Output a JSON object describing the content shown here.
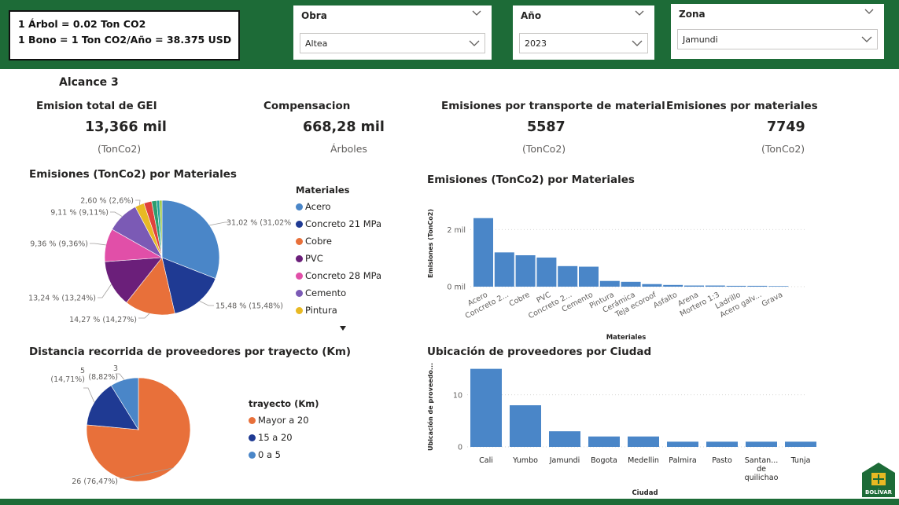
{
  "info": {
    "line1": "1 Árbol = 0.02 Ton CO2",
    "line2": "1 Bono = 1 Ton CO2/Año = 38.375 USD"
  },
  "slicers": {
    "obra": {
      "label": "Obra",
      "value": "Altea"
    },
    "anio": {
      "label": "Año",
      "value": "2023"
    },
    "zona": {
      "label": "Zona",
      "value": "Jamundi"
    }
  },
  "section_title": "Alcance 3",
  "kpis": [
    {
      "title": "Emision total de GEI",
      "value": "13,366 mil",
      "unit": "(TonCo2)"
    },
    {
      "title": "Compensacion",
      "value": "668,28 mil",
      "unit": "Árboles"
    },
    {
      "title": "Emisiones por transporte de material",
      "value": "5587",
      "unit": "(TonCo2)"
    },
    {
      "title": "Emisiones por materiales",
      "value": "7749",
      "unit": "(TonCo2)"
    }
  ],
  "colors": {
    "green_bar": "#1d6b37",
    "blue": "#4a86c8",
    "navy": "#1f3a93",
    "orange": "#e8703a",
    "purple": "#6b1f7a",
    "pink": "#e14fa8",
    "violet": "#7b5ab5",
    "yellow": "#e8b923"
  },
  "chart_data": [
    {
      "type": "pie",
      "title": "Emisiones (TonCo2) por Materiales",
      "legend_title": "Materiales",
      "legend_visible": [
        "Acero",
        "Concreto 21 MPa",
        "Cobre",
        "PVC",
        "Concreto 28 MPa",
        "Cemento",
        "Pintura"
      ],
      "slices": [
        {
          "label": "Acero",
          "value": 31.02,
          "data_label": "31,02 % (31,02%)",
          "color": "#4a86c8"
        },
        {
          "label": "Concreto 21 MPa",
          "value": 15.48,
          "data_label": "15,48 % (15,48%)",
          "color": "#1f3a93"
        },
        {
          "label": "Cobre",
          "value": 14.27,
          "data_label": "14,27 % (14,27%)",
          "color": "#e8703a"
        },
        {
          "label": "PVC",
          "value": 13.24,
          "data_label": "13,24 % (13,24%)",
          "color": "#6b1f7a"
        },
        {
          "label": "Concreto 28 MPa",
          "value": 9.36,
          "data_label": "9,36 % (9,36%)",
          "color": "#e14fa8"
        },
        {
          "label": "Cemento",
          "value": 9.11,
          "data_label": "9,11 % (9,11%)",
          "color": "#7b5ab5"
        },
        {
          "label": "Pintura",
          "value": 2.6,
          "data_label": "2,60 % (2,6%)",
          "color": "#e8b923"
        },
        {
          "label": "",
          "value": 2.2,
          "data_label": "",
          "color": "#e0413c"
        },
        {
          "label": "",
          "value": 1.4,
          "data_label": "",
          "color": "#2e9e6e"
        },
        {
          "label": "",
          "value": 0.8,
          "data_label": "",
          "color": "#1fa09a"
        },
        {
          "label": "",
          "value": 0.72,
          "data_label": "",
          "color": "#9ec843"
        }
      ]
    },
    {
      "type": "bar",
      "title": "Emisiones (TonCo2) por Materiales",
      "xlabel": "Materiales",
      "ylabel": "Emisiones (TonCo2)",
      "ylim": [
        0,
        2.75
      ],
      "yticks": [
        {
          "value": 0,
          "label": "0 mil"
        },
        {
          "value": 2,
          "label": "2 mil"
        }
      ],
      "categories": [
        "Acero",
        "Concreto 2...",
        "Cobre",
        "PVC",
        "Concreto 2...",
        "Cemento",
        "Pintura",
        "Cerámica",
        "Teja ecoroof",
        "Asfalto",
        "Arena",
        "Mortero 1:3",
        "Ladrillo",
        "Acero galv...",
        "Grava"
      ],
      "values": [
        2.4,
        1.2,
        1.1,
        1.02,
        0.72,
        0.7,
        0.2,
        0.17,
        0.09,
        0.06,
        0.04,
        0.04,
        0.03,
        0.03,
        0.02
      ],
      "color": "#4a86c8"
    },
    {
      "type": "pie",
      "title": "Distancia recorrida de proveedores por trayecto (Km)",
      "legend_title": "trayecto (Km)",
      "legend": [
        "Mayor a 20",
        "15 a 20",
        "0 a 5"
      ],
      "slices": [
        {
          "label": "Mayor a 20",
          "value": 26,
          "data_label": "26 (76,47%)",
          "color": "#e8703a"
        },
        {
          "label": "15 a 20",
          "value": 5,
          "data_label_1": "5",
          "data_label_2": "(14,71%)",
          "color": "#1f3a93"
        },
        {
          "label": "0 a 5",
          "value": 3,
          "data_label_1": "3",
          "data_label_2": "(8,82%)",
          "color": "#4a86c8"
        }
      ]
    },
    {
      "type": "bar",
      "title": "Ubicación de proveedores por Ciudad",
      "xlabel": "Ciudad",
      "ylabel": "Ubicación de proveedo...",
      "ylim": [
        0,
        16
      ],
      "yticks": [
        {
          "value": 0,
          "label": "0"
        },
        {
          "value": 10,
          "label": "10"
        }
      ],
      "categories": [
        "Cali",
        "Yumbo",
        "Jamundi",
        "Bogota",
        "Medellin",
        "Palmira",
        "Pasto",
        "Santan... de quilichao",
        "Tunja"
      ],
      "category_lines": [
        [
          "Cali"
        ],
        [
          "Yumbo"
        ],
        [
          "Jamundi"
        ],
        [
          "Bogota"
        ],
        [
          "Medellin"
        ],
        [
          "Palmira"
        ],
        [
          "Pasto"
        ],
        [
          "Santan...",
          "de",
          "quilichao"
        ],
        [
          "Tunja"
        ]
      ],
      "values": [
        15,
        8,
        3,
        2,
        2,
        1,
        1,
        1,
        1
      ],
      "color": "#4a86c8"
    }
  ],
  "logo_text": "BOLÍVAR"
}
